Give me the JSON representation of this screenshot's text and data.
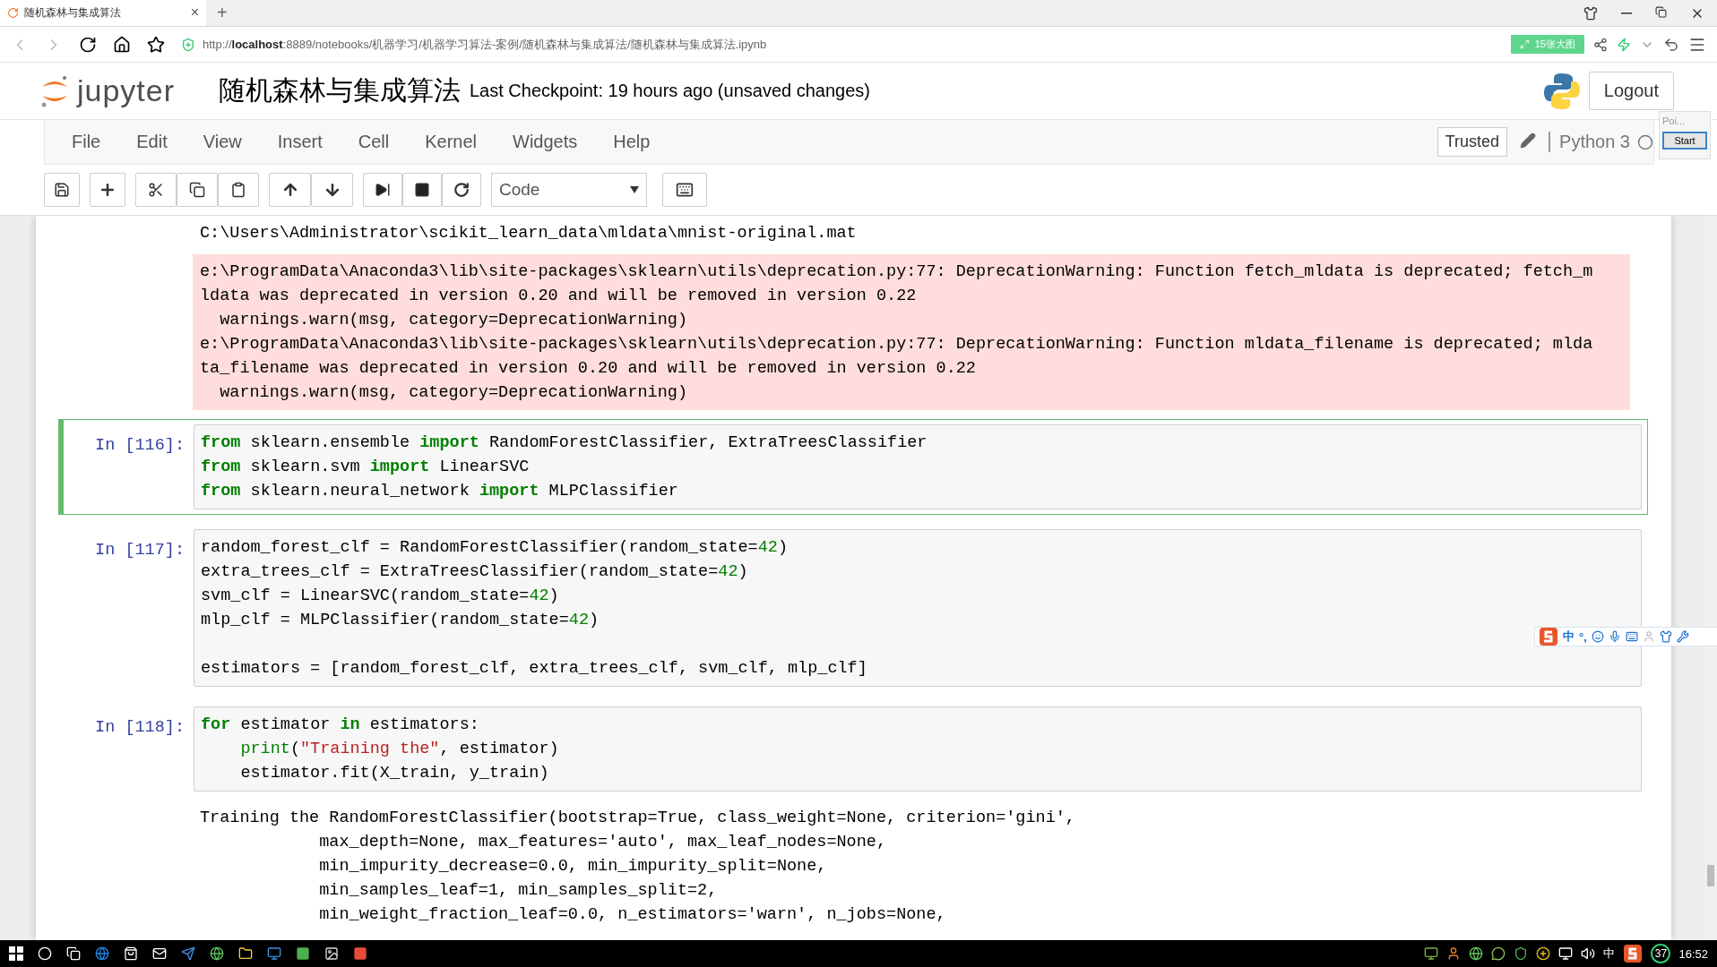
{
  "browser": {
    "tab": {
      "title": "随机森林与集成算法",
      "close": "×",
      "selected": true
    },
    "new_tab": "+",
    "url": "http://**localhost**:8889/notebooks/机器学习/机器学习算法-案例/随机森林与集成算法/随机森林与集成算法.ipynb",
    "badge": "15张大图"
  },
  "header": {
    "logo_text": "jupyter",
    "notebook_title": "随机森林与集成算法",
    "checkpoint": "Last Checkpoint: 19 hours ago (unsaved changes)",
    "logout": "Logout"
  },
  "menu": [
    "File",
    "Edit",
    "View",
    "Insert",
    "Cell",
    "Kernel",
    "Widgets",
    "Help"
  ],
  "trusted": "Trusted",
  "kernel": "Python 3",
  "popup": {
    "title": "Poi...",
    "button": "Start"
  },
  "toolbar": {
    "cell_type": "Code"
  },
  "cells": [
    {
      "kind": "stream",
      "lines": [
        "C:\\Users\\Administrator\\scikit_learn_data\\mldata\\mnist-original.mat"
      ]
    },
    {
      "kind": "stderr",
      "lines": [
        "e:\\ProgramData\\Anaconda3\\lib\\site-packages\\sklearn\\utils\\deprecation.py:77: DeprecationWarning: Function fetch_mldata is deprecated; fetch_m",
        "ldata was deprecated in version 0.20 and will be removed in version 0.22",
        "  warnings.warn(msg, category=DeprecationWarning)",
        "e:\\ProgramData\\Anaconda3\\lib\\site-packages\\sklearn\\utils\\deprecation.py:77: DeprecationWarning: Function mldata_filename is deprecated; mlda",
        "ta_filename was deprecated in version 0.20 and will be removed in version 0.22",
        "  warnings.warn(msg, category=DeprecationWarning)"
      ]
    },
    {
      "kind": "code",
      "prompt": "In [116]:",
      "selected": true,
      "lines": [
        {
          "tokens": [
            {
              "t": "from",
              "kind": "keyword"
            },
            {
              "t": " sklearn.ensemble ",
              "kind": "plain"
            },
            {
              "t": "import",
              "kind": "keyword"
            },
            {
              "t": " RandomForestClassifier, ExtraTreesClassifier",
              "kind": "plain"
            }
          ]
        },
        {
          "tokens": [
            {
              "t": "from",
              "kind": "keyword"
            },
            {
              "t": " sklearn.svm ",
              "kind": "plain"
            },
            {
              "t": "import",
              "kind": "keyword"
            },
            {
              "t": " LinearSVC",
              "kind": "plain"
            }
          ]
        },
        {
          "tokens": [
            {
              "t": "from",
              "kind": "keyword"
            },
            {
              "t": " sklearn.neural_network ",
              "kind": "plain"
            },
            {
              "t": "import",
              "kind": "keyword"
            },
            {
              "t": " MLPClassifier",
              "kind": "plain"
            }
          ]
        }
      ]
    },
    {
      "kind": "code",
      "prompt": "In [117]:",
      "selected": false,
      "lines": [
        {
          "tokens": [
            {
              "t": "random_forest_clf = RandomForestClassifier(random_state=",
              "kind": "plain"
            },
            {
              "t": "42",
              "kind": "number"
            },
            {
              "t": ")",
              "kind": "plain"
            }
          ]
        },
        {
          "tokens": [
            {
              "t": "extra_trees_clf = ExtraTreesClassifier(random_state=",
              "kind": "plain"
            },
            {
              "t": "42",
              "kind": "number"
            },
            {
              "t": ")",
              "kind": "plain"
            }
          ]
        },
        {
          "tokens": [
            {
              "t": "svm_clf = LinearSVC(random_state=",
              "kind": "plain"
            },
            {
              "t": "42",
              "kind": "number"
            },
            {
              "t": ")",
              "kind": "plain"
            }
          ]
        },
        {
          "tokens": [
            {
              "t": "mlp_clf = MLPClassifier(random_state=",
              "kind": "plain"
            },
            {
              "t": "42",
              "kind": "number"
            },
            {
              "t": ")",
              "kind": "plain"
            }
          ]
        },
        {
          "gap_before": true,
          "tokens": [
            {
              "t": "estimators = [random_forest_clf, extra_trees_clf, svm_clf, mlp_clf]",
              "kind": "plain"
            }
          ]
        }
      ]
    },
    {
      "kind": "code",
      "prompt": "In [118]:",
      "selected": false,
      "lines": [
        {
          "tokens": [
            {
              "t": "for",
              "kind": "keyword"
            },
            {
              "t": " estimator ",
              "kind": "plain"
            },
            {
              "t": "in",
              "kind": "keyword"
            },
            {
              "t": " estimators:",
              "kind": "plain"
            }
          ]
        },
        {
          "indented": true,
          "tokens": [
            {
              "t": "print",
              "kind": "builtin"
            },
            {
              "t": "(",
              "kind": "plain"
            },
            {
              "t": "\"Training the\"",
              "kind": "string"
            },
            {
              "t": ", estimator)",
              "kind": "plain"
            }
          ]
        },
        {
          "indented": true,
          "tokens": [
            {
              "t": "estimator.fit(X_train, y_train)",
              "kind": "plain"
            }
          ]
        }
      ]
    },
    {
      "kind": "stream",
      "lines": [
        "Training the RandomForestClassifier(bootstrap=True, class_weight=None, criterion='gini',",
        "            max_depth=None, max_features='auto', max_leaf_nodes=None,",
        "            min_impurity_decrease=0.0, min_impurity_split=None,",
        "            min_samples_leaf=1, min_samples_split=2,",
        "            min_weight_fraction_leaf=0.0, n_estimators='warn', n_jobs=None,"
      ]
    }
  ],
  "ime": {
    "mode": "中",
    "punct": "°,"
  },
  "taskbar": {
    "ime": "中",
    "badge": "37",
    "clock": "16:52"
  }
}
